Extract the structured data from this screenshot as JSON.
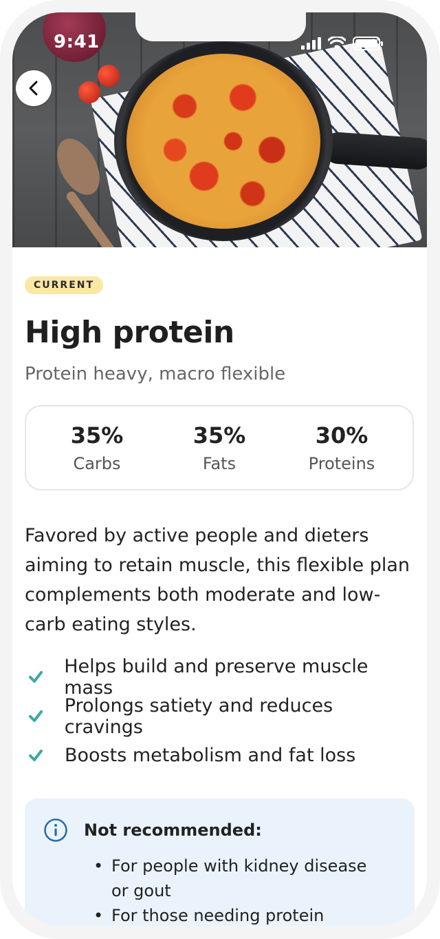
{
  "status_bar": {
    "time": "9:41"
  },
  "hero": {
    "image": "frittata-in-pan-photo"
  },
  "nav": {
    "back_icon": "chevron-left-icon"
  },
  "diet": {
    "badge": "CURRENT",
    "title": "High protein",
    "subtitle": "Protein heavy, macro flexible",
    "macros": [
      {
        "value": "35%",
        "label": "Carbs"
      },
      {
        "value": "35%",
        "label": "Fats"
      },
      {
        "value": "30%",
        "label": "Proteins"
      }
    ],
    "description": "Favored by active people and dieters aiming to retain muscle, this flexible plan complements both moderate and low-carb eating styles.",
    "benefits": [
      "Helps build and preserve muscle mass",
      "Prolongs satiety and reduces cravings",
      "Boosts metabolism and fat loss"
    ]
  },
  "notice": {
    "icon": "info-icon",
    "title": "Not recommended:",
    "items": [
      "For people with kidney disease or gout",
      "For those needing protein"
    ]
  },
  "colors": {
    "badge_bg": "#fbe7a6",
    "check": "#3aa8a4",
    "notice_bg": "#eaf3fc",
    "info_icon": "#2b6ea8"
  }
}
